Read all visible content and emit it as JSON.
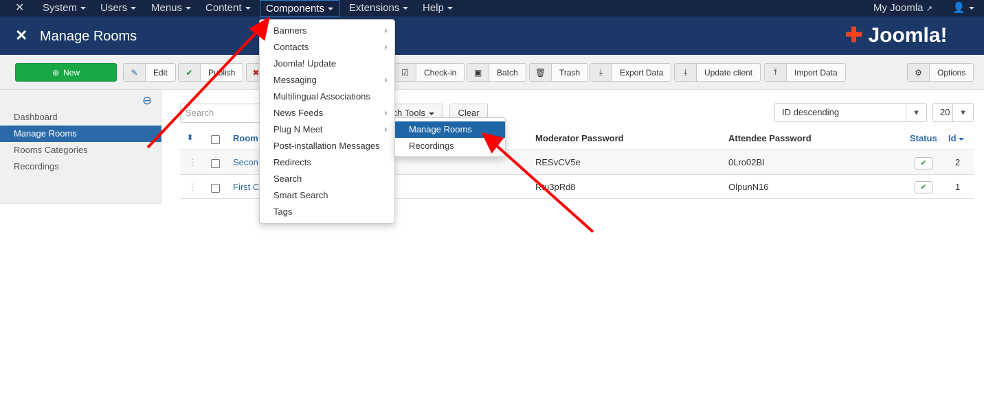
{
  "topnav": {
    "items": [
      "System",
      "Users",
      "Menus",
      "Content",
      "Components",
      "Extensions",
      "Help"
    ],
    "my_joomla": "My Joomla"
  },
  "header": {
    "title": "Manage Rooms",
    "brand": "Joomla!"
  },
  "toolbar": {
    "new": "New",
    "edit": "Edit",
    "publish": "Publish",
    "checkin": "Check-in",
    "batch": "Batch",
    "trash": "Trash",
    "export": "Export Data",
    "update": "Update client",
    "import": "Import Data",
    "options": "Options"
  },
  "sidebar": {
    "items": [
      "Dashboard",
      "Manage Rooms",
      "Rooms Categories",
      "Recordings"
    ],
    "active": "Manage Rooms"
  },
  "filters": {
    "search_placeholder": "Search",
    "search_tools": "ch Tools",
    "clear": "Clear",
    "ordering": "ID descending",
    "limit": "20"
  },
  "table": {
    "headers": {
      "room": "Room",
      "moderator": "Moderator Password",
      "attendee": "Attendee Password",
      "status": "Status",
      "id": "Id"
    },
    "rows": [
      {
        "room": "Secon",
        "moderator": "RESvCV5e",
        "attendee": "0Lro02BI",
        "status": "published",
        "id": "2"
      },
      {
        "room": "First C",
        "moderator": "Rtu3pRd8",
        "attendee": "OlpunN16",
        "status": "published",
        "id": "1"
      }
    ]
  },
  "components_menu": {
    "items": [
      "Banners",
      "Contacts",
      "Joomla! Update",
      "Messaging",
      "Multilingual Associations",
      "News Feeds",
      "Plug N Meet",
      "Post-installation Messages",
      "Redirects",
      "Search",
      "Smart Search",
      "Tags"
    ],
    "with_submenu": [
      0,
      1,
      3,
      5,
      6
    ]
  },
  "submenu": {
    "items": [
      "Manage Rooms",
      "Recordings"
    ],
    "highlighted": "Manage Rooms"
  },
  "annotation_color": "#ff0000"
}
